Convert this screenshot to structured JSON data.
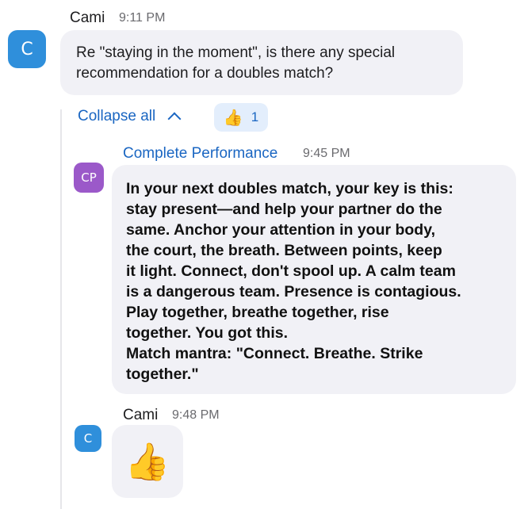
{
  "messages": [
    {
      "sender": "Cami",
      "time": "9:11 PM",
      "avatar_initial": "C",
      "text": "Re \"staying in the moment\", is there any special recommendation for a doubles match?"
    },
    {
      "sender": "Complete Performance",
      "time": "9:45 PM",
      "avatar_initial": "CP",
      "lines": [
        "In your next doubles match, your key is this:",
        "stay present—and help your partner do the",
        "same. Anchor your attention in your body,",
        "the court, the breath. Between points, keep",
        "it light. Connect, don't spool up. A calm team",
        "is a dangerous team. Presence is contagious.",
        "Play together, breathe together, rise",
        "together. You got this.",
        "Match mantra: \"Connect. Breathe. Strike",
        "together.\""
      ]
    },
    {
      "sender": "Cami",
      "time": "9:48 PM",
      "avatar_initial": "C",
      "emoji": "👍"
    }
  ],
  "thread": {
    "collapse_label": "Collapse all",
    "chevron_icon": "chevron-up-icon",
    "reaction": {
      "emoji": "👍",
      "count": "1",
      "icon": "thumbs-up-icon"
    }
  },
  "colors": {
    "link": "#1a66c2",
    "bubble": "#f1f1f6",
    "avatar_cami": "#2f8fdb",
    "avatar_cp": "#9b59c9",
    "reaction_bg": "#e3eefc"
  }
}
